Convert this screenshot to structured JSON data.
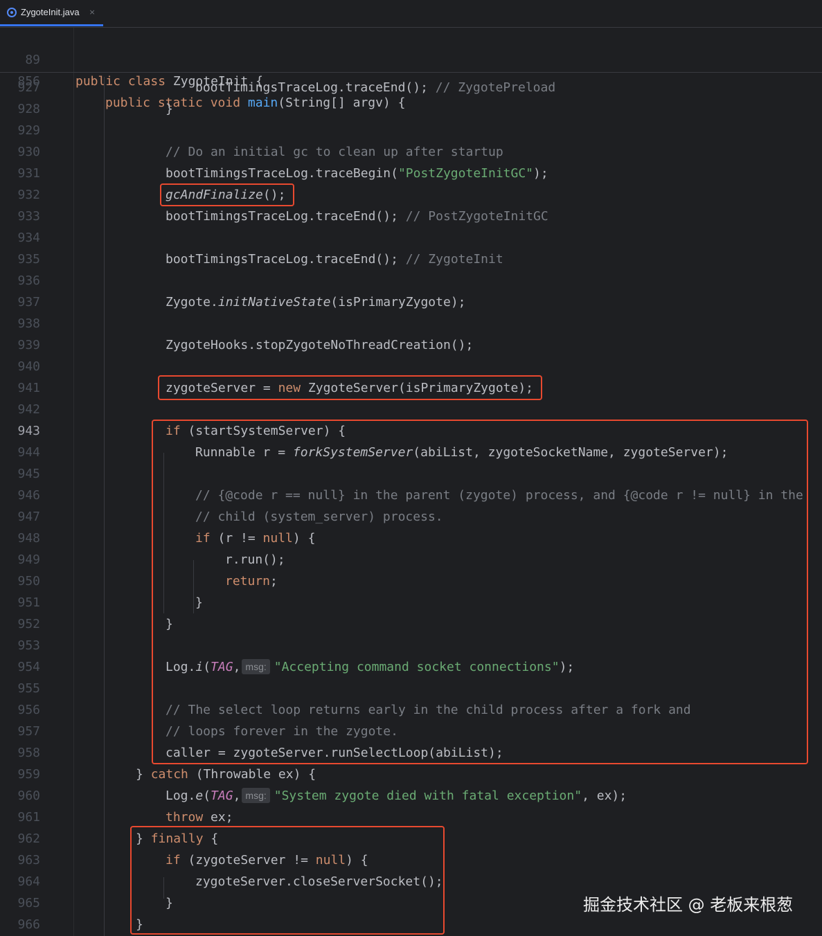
{
  "tab": {
    "title": "ZygoteInit.java",
    "icon": "java-class-icon",
    "close": "×"
  },
  "colors": {
    "background": "#1e1f22",
    "keyword": "#cf8e6d",
    "method": "#56a8f5",
    "string": "#6aab73",
    "comment": "#7a7e85",
    "constant": "#c77dbb",
    "highlight_box": "#e8492f"
  },
  "sticky": [
    {
      "n": "89",
      "t": "public class ZygoteInit {"
    },
    {
      "n": "856",
      "t": "public static void main(String[] argv) {"
    }
  ],
  "lines": [
    {
      "n": "927",
      "a": "bootTimingsTraceLog.traceEnd();",
      "c": "// ZygotePreload"
    },
    {
      "n": "928",
      "a": "}"
    },
    {
      "n": "929"
    },
    {
      "n": "930",
      "c": "// Do an initial gc to clean up after startup"
    },
    {
      "n": "931",
      "a": "bootTimingsTraceLog.traceBegin(",
      "s": "\"PostZygoteInitGC\"",
      "b": ");"
    },
    {
      "n": "932",
      "m": "gcAndFinalize",
      "b": "();"
    },
    {
      "n": "933",
      "a": "bootTimingsTraceLog.traceEnd();",
      "c": "// PostZygoteInitGC"
    },
    {
      "n": "934"
    },
    {
      "n": "935",
      "a": "bootTimingsTraceLog.traceEnd();",
      "c": "// ZygoteInit"
    },
    {
      "n": "936"
    },
    {
      "n": "937",
      "a": "Zygote.",
      "m": "initNativeState",
      "b": "(isPrimaryZygote);"
    },
    {
      "n": "938"
    },
    {
      "n": "939",
      "a": "ZygoteHooks.stopZygoteNoThreadCreation();"
    },
    {
      "n": "940"
    },
    {
      "n": "941",
      "a": "zygoteServer = ",
      "k": "new",
      "b": " ZygoteServer(isPrimaryZygote);"
    },
    {
      "n": "942"
    },
    {
      "n": "943",
      "k": "if",
      "b": " (startSystemServer) {"
    },
    {
      "n": "944",
      "a": "Runnable r = ",
      "m": "forkSystemServer",
      "b": "(abiList, zygoteSocketName, zygoteServer);"
    },
    {
      "n": "945"
    },
    {
      "n": "946",
      "c": "// {@code r == null} in the parent (zygote) process, and {@code r != null} in the"
    },
    {
      "n": "947",
      "c": "// child (system_server) process."
    },
    {
      "n": "948",
      "k": "if",
      "a": " (r != ",
      "k2": "null",
      "b": ") {"
    },
    {
      "n": "949",
      "a": "r.run();"
    },
    {
      "n": "950",
      "k": "return",
      "b": ";"
    },
    {
      "n": "951",
      "a": "}"
    },
    {
      "n": "952",
      "a": "}"
    },
    {
      "n": "953"
    },
    {
      "n": "954",
      "a": "Log.",
      "m": "i",
      "p": "(",
      "tag": "TAG",
      "q": ",",
      "hint": "msg:",
      "s": "\"Accepting command socket connections\"",
      "b": ");"
    },
    {
      "n": "955"
    },
    {
      "n": "956",
      "c": "// The select loop returns early in the child process after a fork and"
    },
    {
      "n": "957",
      "c": "// loops forever in the zygote."
    },
    {
      "n": "958",
      "a": "caller = zygoteServer.runSelectLoop(abiList);"
    },
    {
      "n": "959",
      "a": "} ",
      "k": "catch",
      "b": " (Throwable ex) {"
    },
    {
      "n": "960",
      "a": "Log.",
      "m": "e",
      "p": "(",
      "tag": "TAG",
      "q": ",",
      "hint": "msg:",
      "s": "\"System zygote died with fatal exception\"",
      "b": ", ex);"
    },
    {
      "n": "961",
      "k": "throw",
      "b": " ex;"
    },
    {
      "n": "962",
      "a": "} ",
      "k": "finally",
      "b": " {"
    },
    {
      "n": "963",
      "k": "if",
      "a": " (zygoteServer != ",
      "k2": "null",
      "b": ") {"
    },
    {
      "n": "964",
      "a": "zygoteServer.closeServerSocket();"
    },
    {
      "n": "965",
      "a": "}"
    },
    {
      "n": "966",
      "a": "}"
    }
  ],
  "watermark": "掘金技术社区 @ 老板来根葱"
}
